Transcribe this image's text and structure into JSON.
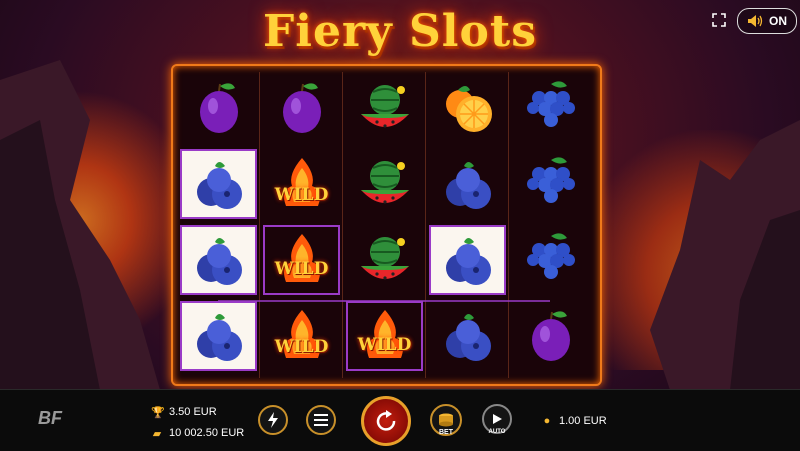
{
  "game": {
    "title": "Fiery Slots",
    "sound_toggle": "ON",
    "fullscreen_icon": "fullscreen-icon",
    "sound_icon": "speaker-icon",
    "brand_logo": "BF"
  },
  "reels": [
    [
      "plum",
      "blueberry",
      "blueberry",
      "blueberry"
    ],
    [
      "plum",
      "wild",
      "wild",
      "wild"
    ],
    [
      "watermelon",
      "watermelon",
      "watermelon",
      "wild"
    ],
    [
      "orange",
      "blueberry",
      "blueberry",
      "blueberry"
    ],
    [
      "grapes",
      "grapes",
      "grapes",
      "plum"
    ]
  ],
  "wild_label": "WILD",
  "highlighted_cells": [
    [
      0,
      1
    ],
    [
      0,
      2
    ],
    [
      0,
      3
    ],
    [
      1,
      2
    ],
    [
      2,
      3
    ],
    [
      3,
      2
    ]
  ],
  "colors": {
    "accent": "#f07a1a",
    "win_line": "#9a3bc7",
    "title": "#ffd23a",
    "spin": "#c21d0d"
  },
  "bottom_bar": {
    "win_label": "3.50 EUR",
    "balance_label": "10 002.50 EUR",
    "bet_button_label": "BET",
    "auto_button_label": "AUTO",
    "bet_value": "1.00 EUR",
    "icons": {
      "win": "trophy-icon",
      "balance": "wallet-icon",
      "turbo": "lightning-icon",
      "menu": "menu-icon",
      "spin": "spin-arrow-icon",
      "bet": "coin-stack-icon",
      "auto": "play-icon",
      "bet_value": "coins-icon"
    }
  }
}
